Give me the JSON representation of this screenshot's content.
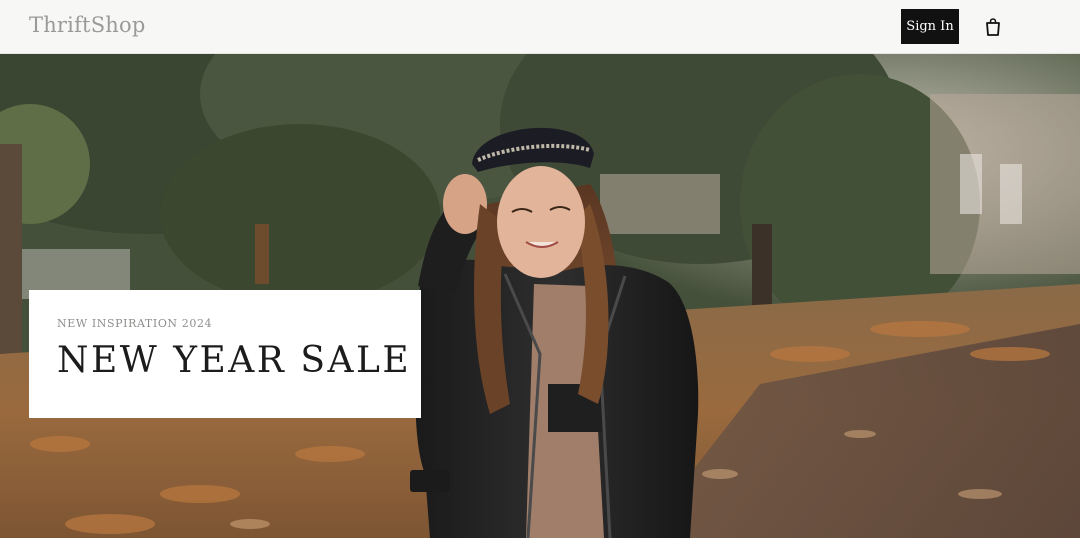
{
  "header": {
    "brand": "ThriftShop",
    "signin_label": "Sign In",
    "cart_icon": "shopping-bag-icon"
  },
  "hero": {
    "image_alt": "",
    "promo": {
      "kicker": "NEW INSPIRATION 2024",
      "title": "NEW YEAR SALE"
    }
  },
  "colors": {
    "header_bg": "#f7f7f6",
    "brand_text": "#9a9a98",
    "signin_bg": "#111111",
    "signin_text": "#ffffff",
    "promo_bg": "#ffffff",
    "promo_title": "#1c1c1c"
  }
}
